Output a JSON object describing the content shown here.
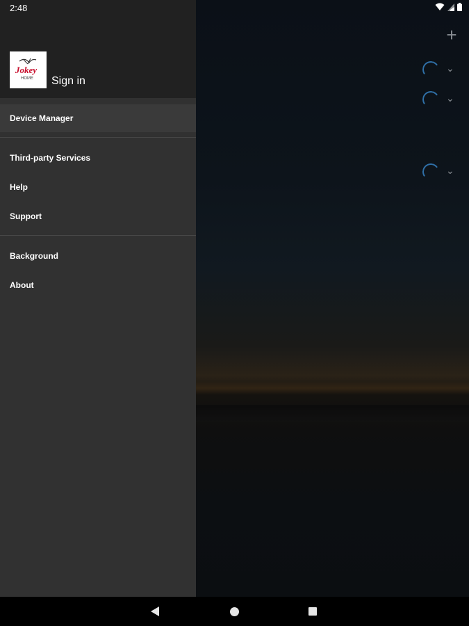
{
  "status_bar": {
    "time": "2:48",
    "icons": [
      "wifi-icon",
      "signal-icon",
      "battery-icon"
    ]
  },
  "drawer": {
    "logo": {
      "brand": "Jokey",
      "sub": "HOME"
    },
    "sign_in": "Sign in",
    "items": [
      {
        "label": "Device Manager",
        "active": true
      },
      {
        "label": "Third-party Services"
      },
      {
        "label": "Help"
      },
      {
        "label": "Support"
      },
      {
        "label": "Background"
      },
      {
        "label": "About"
      }
    ]
  },
  "background_controls": {
    "add_icon": "plus-icon",
    "rows": 3
  },
  "nav_bar": {
    "buttons": [
      "back",
      "home",
      "recents"
    ]
  },
  "colors": {
    "drawer_bg": "#313131",
    "header_bg": "#212121",
    "spinner": "#2f6fa6"
  }
}
